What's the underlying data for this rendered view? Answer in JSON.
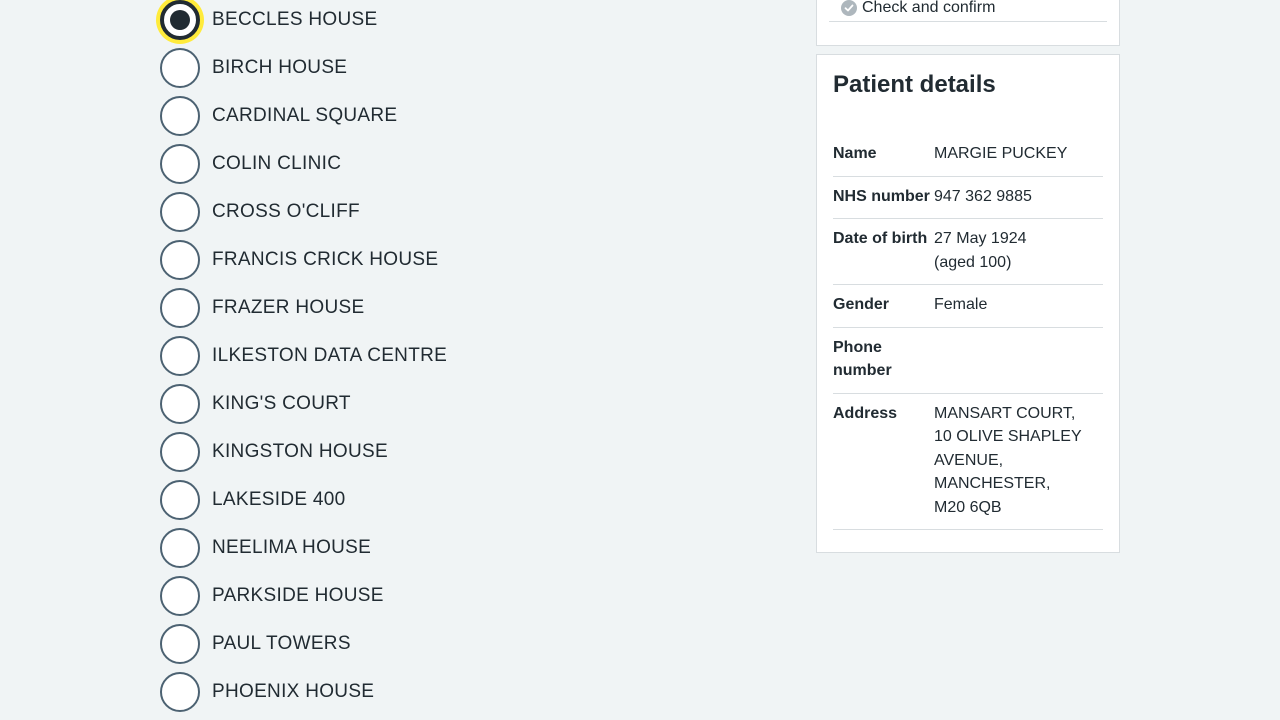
{
  "locations": [
    {
      "label": "BECCLES HOUSE",
      "selected": true
    },
    {
      "label": "BIRCH HOUSE",
      "selected": false
    },
    {
      "label": "CARDINAL SQUARE",
      "selected": false
    },
    {
      "label": "COLIN CLINIC",
      "selected": false
    },
    {
      "label": "CROSS O'CLIFF",
      "selected": false
    },
    {
      "label": "FRANCIS CRICK HOUSE",
      "selected": false
    },
    {
      "label": "FRAZER HOUSE",
      "selected": false
    },
    {
      "label": "ILKESTON DATA CENTRE",
      "selected": false
    },
    {
      "label": "KING'S COURT",
      "selected": false
    },
    {
      "label": "KINGSTON HOUSE",
      "selected": false
    },
    {
      "label": "LAKESIDE 400",
      "selected": false
    },
    {
      "label": "NEELIMA HOUSE",
      "selected": false
    },
    {
      "label": "PARKSIDE HOUSE",
      "selected": false
    },
    {
      "label": "PAUL TOWERS",
      "selected": false
    },
    {
      "label": "PHOENIX HOUSE",
      "selected": false
    }
  ],
  "steps": {
    "check_and_confirm": "Check and confirm",
    "check_icon": "check-circle-icon"
  },
  "patient": {
    "title": "Patient details",
    "rows": [
      {
        "key": "Name",
        "value": "MARGIE PUCKEY"
      },
      {
        "key": "NHS number",
        "value": "947 362 9885"
      },
      {
        "key": "Date of birth",
        "value": "27 May 1924\n(aged 100)"
      },
      {
        "key": "Gender",
        "value": "Female"
      },
      {
        "key": "Phone number",
        "value": ""
      },
      {
        "key": "Address",
        "value": "MANSART COURT,\n10 OLIVE SHAPLEY\nAVENUE,\nMANCHESTER,\nM20 6QB"
      }
    ]
  },
  "colors": {
    "background": "#f0f4f5",
    "text": "#212b32",
    "radio_border": "#4c6272",
    "focus": "#ffeb3b",
    "divider": "#d8dde0"
  }
}
